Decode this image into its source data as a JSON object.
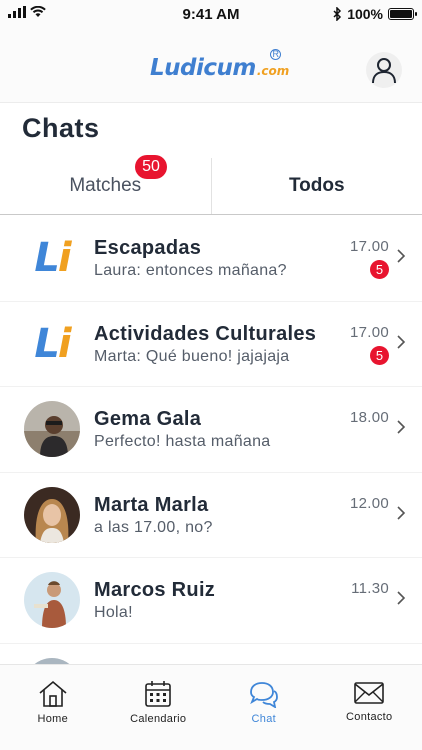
{
  "status_bar": {
    "time": "9:41 AM",
    "battery": "100%"
  },
  "header": {
    "brand": "Ludicum",
    "tld": ".com",
    "reg": "R"
  },
  "page": {
    "title": "Chats"
  },
  "tabs": [
    {
      "label": "Matches",
      "badge": "50",
      "active": false
    },
    {
      "label": "Todos",
      "active": true
    }
  ],
  "chats": [
    {
      "name": "Escapadas",
      "preview": "Laura: entonces mañana?",
      "time": "17.00",
      "unread": "5",
      "avatar": "ludicum-logo"
    },
    {
      "name": "Actividades Culturales",
      "preview": "Marta: Qué bueno! jajajaja",
      "time": "17.00",
      "unread": "5",
      "avatar": "ludicum-logo"
    },
    {
      "name": "Gema Gala",
      "preview": "Perfecto! hasta mañana",
      "time": "18.00",
      "avatar": "photo"
    },
    {
      "name": "Marta Marla",
      "preview": "a las 17.00, no?",
      "time": "12.00",
      "avatar": "photo"
    },
    {
      "name": "Marcos Ruiz",
      "preview": "Hola!",
      "time": "11.30",
      "avatar": "photo"
    }
  ],
  "nav": [
    {
      "label": "Home",
      "icon": "home-icon"
    },
    {
      "label": "Calendario",
      "icon": "calendar-icon"
    },
    {
      "label": "Chat",
      "icon": "chat-icon",
      "active": true
    },
    {
      "label": "Contacto",
      "icon": "mail-icon"
    }
  ],
  "colors": {
    "accent": "#3f86d8",
    "badge": "#e8142f",
    "logo_orange": "#f0a020"
  }
}
